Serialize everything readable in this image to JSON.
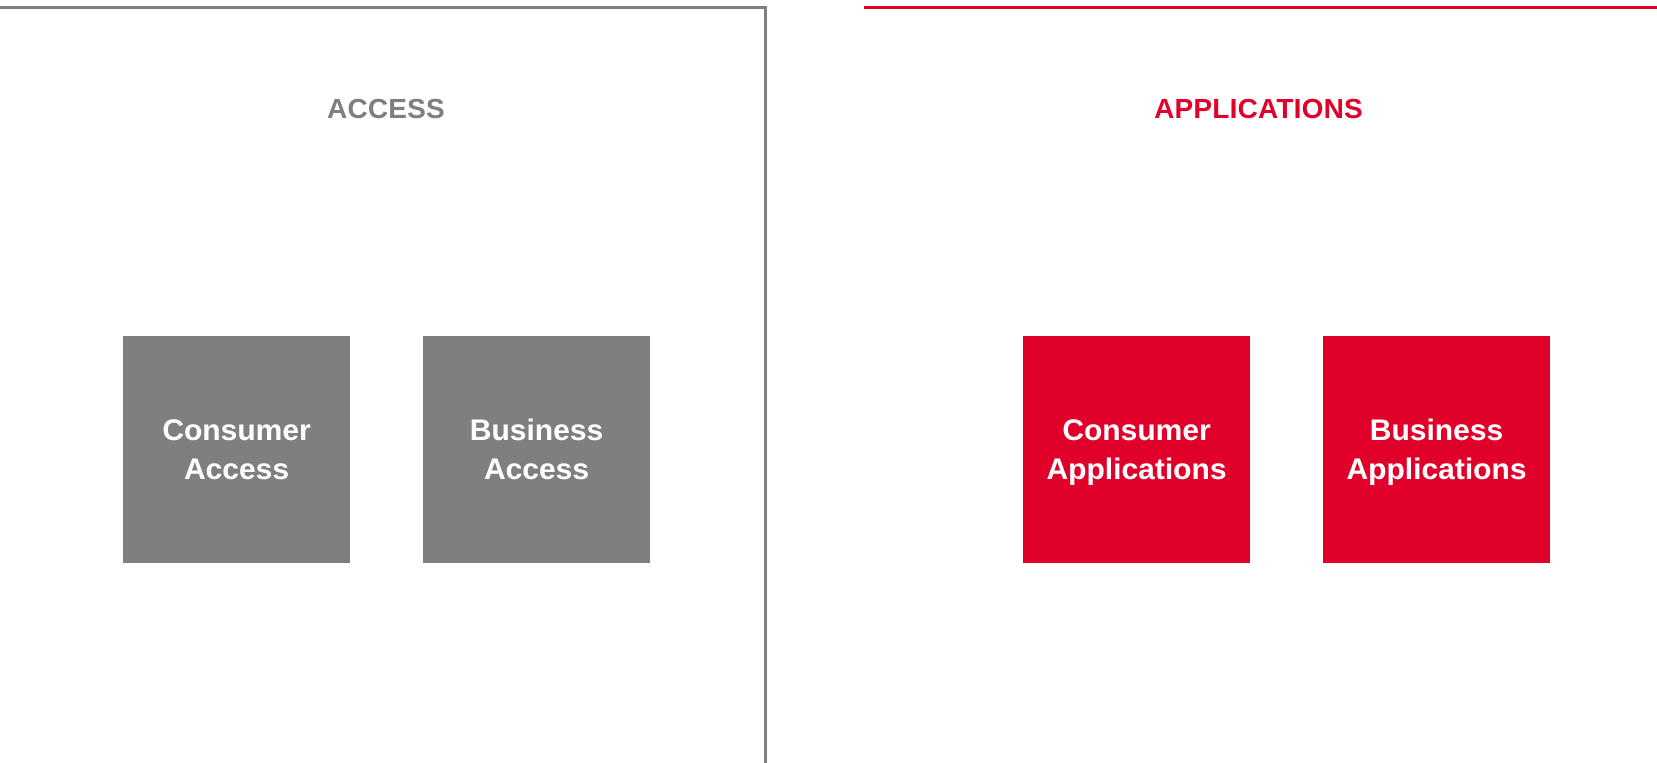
{
  "colors": {
    "access": "#7f7f7f",
    "applications": "#e0002a",
    "box_text": "#ffffff",
    "background": "#ffffff"
  },
  "access": {
    "title": "ACCESS",
    "boxes": [
      {
        "line1": "Consumer",
        "line2": "Access"
      },
      {
        "line1": "Business",
        "line2": "Access"
      }
    ]
  },
  "applications": {
    "title": "APPLICATIONS",
    "boxes": [
      {
        "line1": "Consumer",
        "line2": "Applications"
      },
      {
        "line1": "Business",
        "line2": "Applications"
      }
    ]
  }
}
